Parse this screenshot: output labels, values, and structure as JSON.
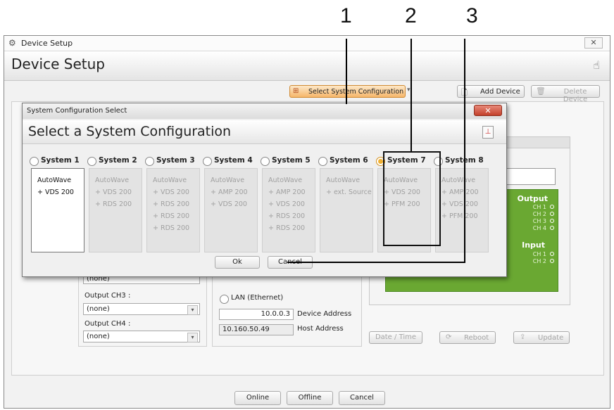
{
  "callouts": [
    "1",
    "2",
    "3"
  ],
  "outer_window": {
    "titlebar_title": "Device Setup",
    "close_glyph": "✕",
    "header_title": "Device Setup"
  },
  "toolbar": {
    "select_config_label": "Select System Configuration",
    "add_device_label": "Add Device",
    "delete_device_label": "Delete Device"
  },
  "modal": {
    "title": "System Configuration Select",
    "close_glyph": "✕",
    "header_title": "Select a System Configuration",
    "systems": [
      {
        "label": "System 1",
        "items": [
          "AutoWave",
          "+ VDS 200"
        ],
        "active": true,
        "selected": false
      },
      {
        "label": "System 2",
        "items": [
          "AutoWave",
          "+ VDS 200",
          "+ RDS 200"
        ],
        "active": false,
        "selected": false
      },
      {
        "label": "System 3",
        "items": [
          "AutoWave",
          "+ VDS 200",
          "+ RDS 200",
          "+ RDS 200",
          "+ RDS 200"
        ],
        "active": false,
        "selected": false
      },
      {
        "label": "System 4",
        "items": [
          "AutoWave",
          "+ AMP 200",
          "+ VDS 200"
        ],
        "active": false,
        "selected": false
      },
      {
        "label": "System 5",
        "items": [
          "AutoWave",
          "+ AMP 200",
          "+ VDS 200",
          "+ RDS 200",
          "+ RDS 200"
        ],
        "active": false,
        "selected": false
      },
      {
        "label": "System 6",
        "items": [
          "AutoWave",
          "+ ext. Source"
        ],
        "active": false,
        "selected": false
      },
      {
        "label": "System 7",
        "items": [
          "AutoWave",
          "+ VDS 200",
          "+ PFM 200"
        ],
        "active": false,
        "selected": true
      },
      {
        "label": "System 8",
        "items": [
          "AutoWave",
          "+ AMP 200",
          "+ VDS 200",
          "+ PFM 200"
        ],
        "active": false,
        "selected": false
      }
    ],
    "ok_label": "Ok",
    "cancel_label": "Cancel"
  },
  "device_panel": {
    "output_label": "Output",
    "output_channels": [
      "CH 1",
      "CH 2",
      "CH 3",
      "CH 4"
    ],
    "input_label": "Input",
    "input_channels": [
      "CH 1",
      "CH 2"
    ],
    "panel_color": "#6aa832"
  },
  "form": {
    "ch2_value": "(none)",
    "ch3_label": "Output CH3 :",
    "ch3_value": "(none)",
    "ch4_label": "Output CH4 :",
    "ch4_value": "(none)",
    "lan_label": "LAN (Ethernet)",
    "device_address_value": "10.0.0.3",
    "device_address_label": "Device Address",
    "host_address_value": "10.160.50.49",
    "host_address_label": "Host Address",
    "date_time_label": "Date / Time",
    "reboot_label": "Reboot",
    "update_label": "Update"
  },
  "footer": {
    "online_label": "Online",
    "offline_label": "Offline",
    "cancel_label": "Cancel"
  }
}
